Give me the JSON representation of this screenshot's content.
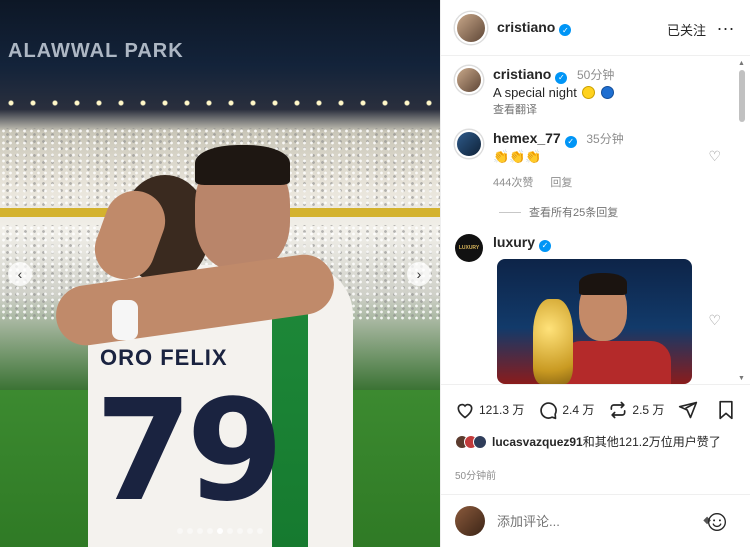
{
  "photo": {
    "stadium_text": "ALAWWAL PARK",
    "jersey_name": "ORO FELIX",
    "jersey_number": "79",
    "slides": 9,
    "active_slide": 4
  },
  "header": {
    "username": "cristiano",
    "follow_status": "已关注",
    "more": "..."
  },
  "caption": {
    "username": "cristiano",
    "time": "50分钟",
    "text": "A special night",
    "translate": "查看翻译"
  },
  "comments": [
    {
      "username": "hemex_77",
      "time": "35分钟",
      "text": "👏👏👏",
      "likes": "444次赞",
      "reply": "回复",
      "view_replies": "查看所有25条回复"
    },
    {
      "username": "luxury",
      "avatar_text": "LUXURY"
    }
  ],
  "actions": {
    "likes_count": "121.3 万",
    "comments_count": "2.4 万",
    "reposts_count": "2.5 万"
  },
  "liked_by": {
    "user": "lucasvazquez91",
    "rest": "和其他121.2万位用户赞了"
  },
  "posted_time": "50分钟前",
  "add_comment": {
    "placeholder": "添加评论..."
  },
  "colors": {
    "verified": "#0095f6",
    "meta": "#8e8e8e"
  }
}
